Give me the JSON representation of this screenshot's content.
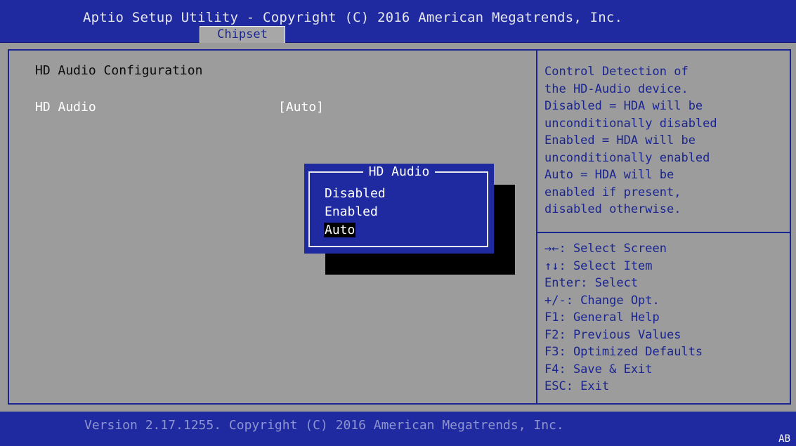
{
  "header": {
    "title": "Aptio Setup Utility - Copyright (C) 2016 American Megatrends, Inc.",
    "tabs": [
      {
        "label": "Chipset"
      }
    ]
  },
  "main": {
    "section_title": "HD Audio Configuration",
    "setting": {
      "label": "HD Audio",
      "value": "[Auto]"
    }
  },
  "help": {
    "lines": [
      "Control Detection of",
      "the HD-Audio device.",
      "Disabled = HDA will be",
      "unconditionally disabled",
      "Enabled = HDA will be",
      "unconditionally enabled",
      "Auto = HDA will be",
      "enabled if present,",
      "disabled otherwise."
    ],
    "keys": [
      "→←: Select Screen",
      "↑↓: Select Item",
      "Enter: Select",
      "+/-: Change Opt.",
      "F1: General Help",
      "F2: Previous Values",
      "F3: Optimized Defaults",
      "F4: Save & Exit",
      "ESC: Exit"
    ]
  },
  "popup": {
    "title": "HD Audio",
    "options": [
      {
        "label": "Disabled",
        "selected": false
      },
      {
        "label": "Enabled",
        "selected": false
      },
      {
        "label": "Auto",
        "selected": true
      }
    ]
  },
  "footer": {
    "text": "Version 2.17.1255. Copyright (C) 2016 American Megatrends, Inc.",
    "corner": "AB"
  },
  "colors": {
    "header_bg": "#1f2aa0",
    "panel_bg": "#9c9c9c",
    "help_text": "#1a2590",
    "popup_bg": "#1f2aa0",
    "selected_bg": "#000000"
  }
}
